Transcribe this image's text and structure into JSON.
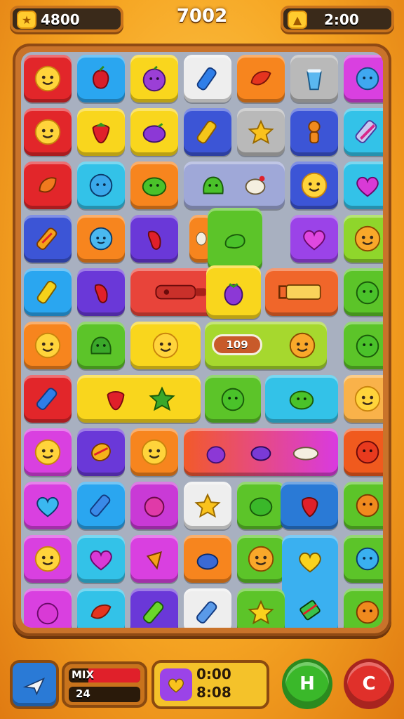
{
  "hud": {
    "coins": "4800",
    "score": "7002",
    "timer": "2:00"
  },
  "board": {
    "powerup_label": "109"
  },
  "bottom": {
    "bar_label": "MIX",
    "bar_value": "24",
    "time_line1": "0:00",
    "time_line2": "8:08",
    "hint_glyph": "H",
    "refresh_glyph": "C"
  },
  "icons": [
    "coin-icon",
    "bolt-icon",
    "smiley-icon",
    "berry-icon",
    "bomb-icon",
    "candy-icon",
    "heart-icon",
    "bottle-icon",
    "cup-icon",
    "star-icon",
    "plane-icon"
  ],
  "colors": {
    "board_frame": "#c9732a",
    "red": "#e2262a",
    "blue": "#2aa6f0",
    "yellow": "#f9d61d",
    "green": "#5cc429",
    "purple": "#9b43e8",
    "orange": "#f7851e"
  }
}
